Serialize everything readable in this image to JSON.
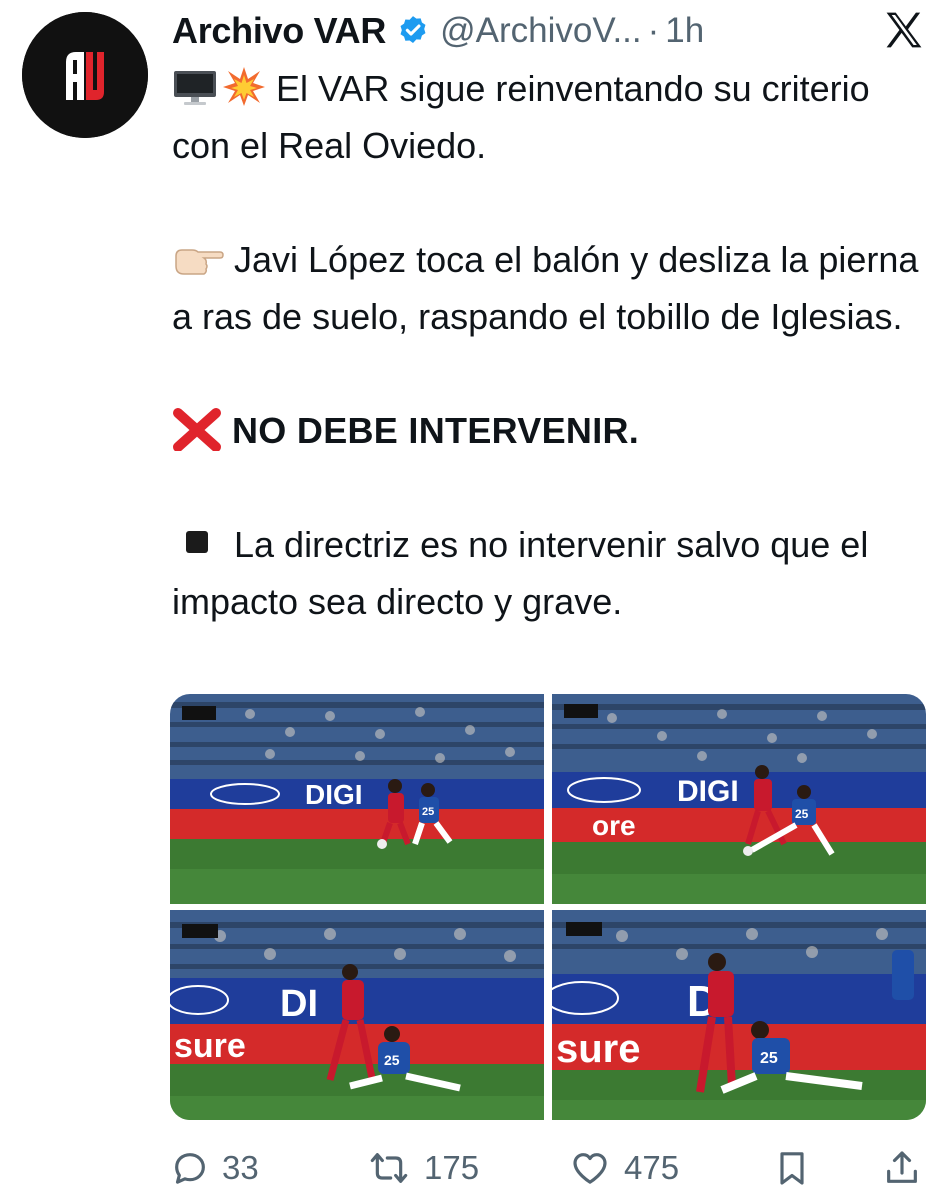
{
  "author": {
    "name": "Archivo VAR",
    "handle": "@ArchivoV...",
    "separator": "·",
    "time": "1h",
    "avatar_initials": "AV",
    "avatar_icon": "archivo-var-logo",
    "verified_icon": "verified-badge-icon"
  },
  "tweet": {
    "line1": "El VAR sigue reinventando su criterio con el Real Oviedo.",
    "line2": "Javi López toca el balón y desliza la pierna a ras de suelo, raspando el tobillo de Iglesias.",
    "line3": "NO DEBE INTERVENIR.",
    "line4": "La directriz es no intervenir salvo que el impacto sea directo y grave.",
    "emojis": [
      "desktop-computer-emoji",
      "collision-emoji",
      "pointing-right-emoji",
      "cross-mark-emoji",
      "black-square-emoji"
    ]
  },
  "media": {
    "count": 4,
    "tiles": [
      {
        "id": "top-left",
        "board_text": "DIGI",
        "ad_text": "",
        "player_number": "25"
      },
      {
        "id": "top-right",
        "board_text": "DIGI",
        "ad_text": "ore",
        "player_number": "25"
      },
      {
        "id": "bottom-left",
        "board_text": "DI",
        "ad_text": "sure",
        "player_number": "25"
      },
      {
        "id": "bottom-right",
        "board_text": "D",
        "ad_text": "sure",
        "player_number": "25"
      }
    ]
  },
  "actions": {
    "replies": "33",
    "reposts": "175",
    "likes": "475"
  },
  "colors": {
    "text": "#0f1419",
    "secondary": "#536471",
    "verified": "#1d9bf0",
    "cross": "#e0242c",
    "pitch": "#3c7a32",
    "board_blue": "#1f3d9b",
    "ad_red": "#d42a2a",
    "player_red": "#c8192d",
    "player_blue": "#1f4fa8"
  }
}
